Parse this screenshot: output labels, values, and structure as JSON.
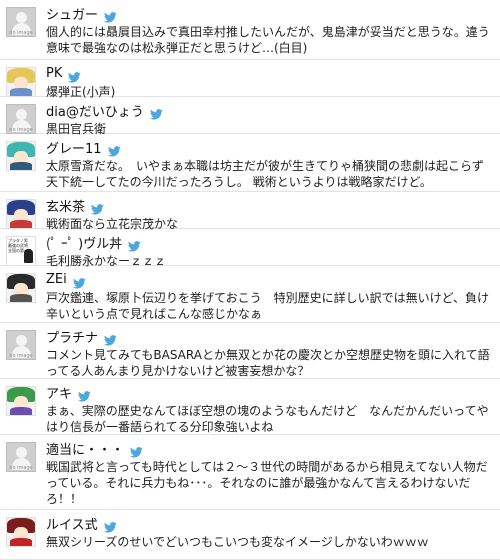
{
  "tweets": [
    {
      "name": "シュガー",
      "avatar": "no-image",
      "text": "個人的には贔屓目込みで真田幸村推したいんだが、鬼島津が妥当だと思うな。違う意味で最強なのは松永弾正だと思うけど…(白目)"
    },
    {
      "name": "PK",
      "avatar": "anime-blonde",
      "text": "爆弾正(小声)"
    },
    {
      "name": "dia@だいひょう",
      "avatar": "no-image",
      "text": "黒田官兵衛"
    },
    {
      "name": "グレー11",
      "avatar": "anime-teal",
      "text": "太原雪斎だな。　いやまぁ本職は坊主だが彼が生きてりゃ桶狭間の悲劇は起こらず天下統一してたの今川だったろうし。 戦術というよりは戦略家だけど。"
    },
    {
      "name": "玄米茶",
      "avatar": "anime-blue",
      "text": "戦術面なら立花宗茂かな"
    },
    {
      "name": "(ﾟ ｰﾟ )ヴル丼",
      "avatar": "text-art",
      "text": "毛利勝永かなーｚｚｚ"
    },
    {
      "name": "ZEi",
      "avatar": "anime-dark",
      "text": "戸次鑑連、塚原卜伝辺りを挙げておこう　特別歴史に詳しい訳では無いけど、負け辛いという点で見ればこんな感じかなぁ"
    },
    {
      "name": "プラチナ",
      "avatar": "no-image",
      "text": "コメント見てみてもBASARAとか無双とか花の慶次とか空想歴史物を頭に入れて語ってる人あんまり見かけないけど被害妄想かな？"
    },
    {
      "name": "アキ",
      "avatar": "anime-green",
      "text": "まぁ、実際の歴史なんてほぼ空想の塊のようなもんだけど　なんだかんだいってやはり信長が一番語られてる分印象強いよね"
    },
    {
      "name": "適当に・・・",
      "avatar": "no-image",
      "text": "戦国武将と言っても時代としては２～３世代の時間があるから相見えてない人物だっている。それに兵力もね･･･。それなのに誰が最強かなんて言えるわけないだろ！！"
    },
    {
      "name": "ルイス式",
      "avatar": "anime-red",
      "text": "無双シリーズのせいでどいつもこいつも変なイメージしかないわｗｗｗ"
    }
  ],
  "avatar_labels": {
    "no_image": "no image",
    "text_art": "プラタノ男\n最強の武将\n全国の第一人"
  },
  "colors": {
    "bird": "#4da7de",
    "divider": "#e3e3e3"
  }
}
